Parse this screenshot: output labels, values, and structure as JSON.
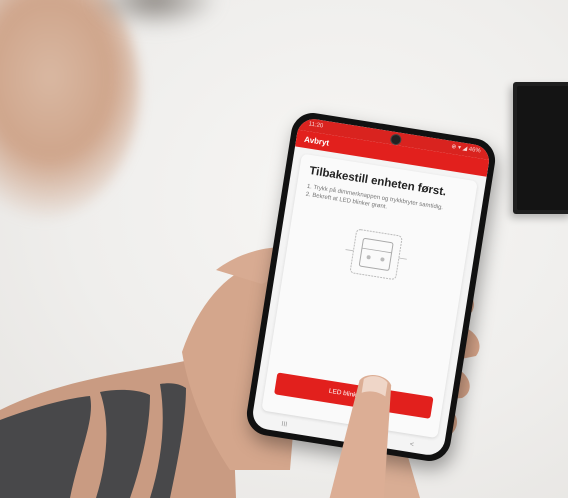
{
  "phone": {
    "status_time": "11:20",
    "status_icons": "⊕ ▾ ◢ 46%",
    "cancel_label": "Avbryt",
    "title": "Tilbakestill enheten først.",
    "steps": [
      "1. Trykk på dimmerknappen og trykkbryter samtidig.",
      "2. Bekreft at LED blinker grønt."
    ],
    "led_button_label": "LED blinker grønt",
    "nav": {
      "recents": "III",
      "home": "○",
      "back": "<"
    }
  },
  "colors": {
    "accent_red": "#e2201d",
    "wall": "#f2f1ef",
    "phone_body": "#111111"
  },
  "icons": [
    "camera-icon",
    "recents-icon",
    "home-icon",
    "back-icon"
  ]
}
